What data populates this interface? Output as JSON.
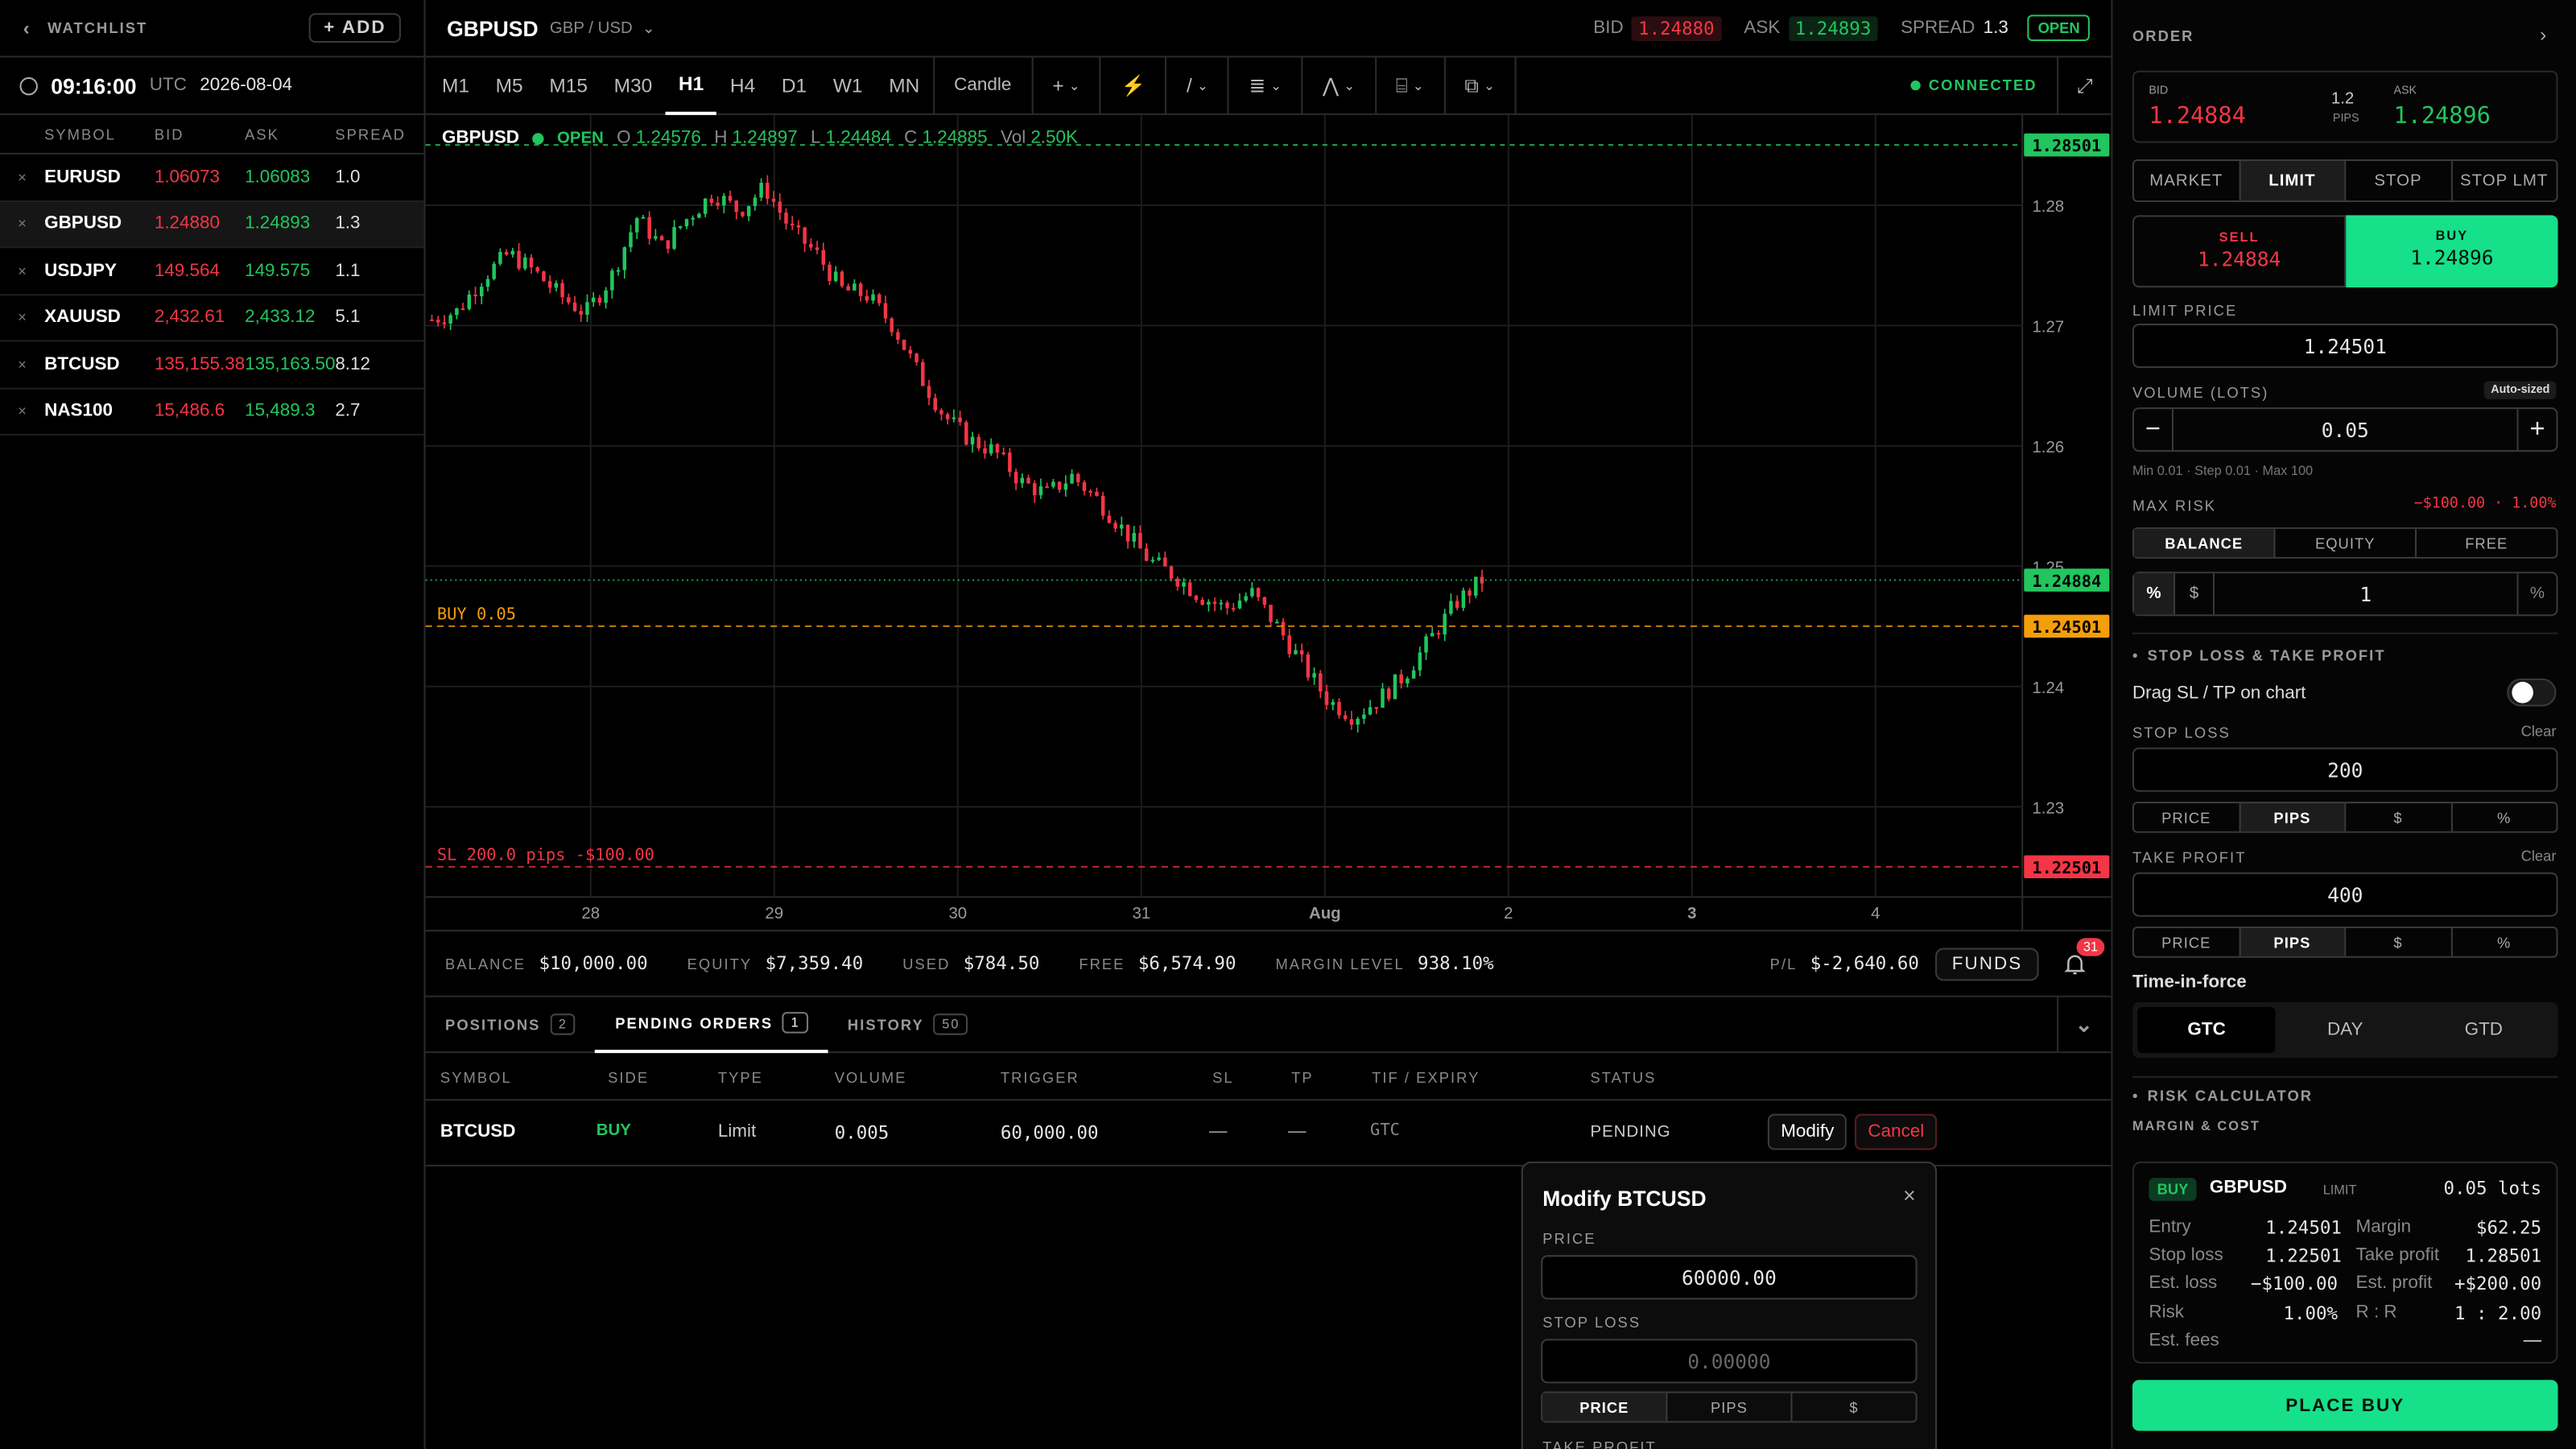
{
  "watchlist": {
    "title": "WATCHLIST",
    "add_label": "+ ADD",
    "clock": {
      "time": "09:16:00",
      "tz": "UTC",
      "date": "2026-08-04"
    },
    "columns": [
      "SYMBOL",
      "BID",
      "ASK",
      "SPREAD"
    ],
    "rows": [
      {
        "remove": "×",
        "symbol": "EURUSD",
        "bid": "1.06073",
        "ask": "1.06083",
        "spread": "1.0"
      },
      {
        "remove": "×",
        "symbol": "GBPUSD",
        "bid": "1.24880",
        "ask": "1.24893",
        "spread": "1.3"
      },
      {
        "remove": "×",
        "symbol": "USDJPY",
        "bid": "149.564",
        "ask": "149.575",
        "spread": "1.1"
      },
      {
        "remove": "×",
        "symbol": "XAUUSD",
        "bid": "2,432.61",
        "ask": "2,433.12",
        "spread": "5.1"
      },
      {
        "remove": "×",
        "symbol": "BTCUSD",
        "bid": "135,155.38",
        "ask": "135,163.50",
        "spread": "8.12"
      },
      {
        "remove": "×",
        "symbol": "NAS100",
        "bid": "15,486.6",
        "ask": "15,489.3",
        "spread": "2.7"
      }
    ]
  },
  "header": {
    "symbol": "GBPUSD",
    "pair": "GBP / USD",
    "bid_label": "BID",
    "bid": "1.24880",
    "ask_label": "ASK",
    "ask": "1.24893",
    "spread_label": "SPREAD",
    "spread": "1.3",
    "status": "OPEN"
  },
  "toolbar": {
    "timeframes": [
      "M1",
      "M5",
      "M15",
      "M30",
      "H1",
      "H4",
      "D1",
      "W1",
      "MN"
    ],
    "active_timeframe": "H1",
    "chart_type": "Candle",
    "connection": "CONNECTED"
  },
  "chart": {
    "legend_symbol": "GBPUSD",
    "legend_status": "OPEN",
    "ohlc": {
      "o_label": "O",
      "o": "1.24576",
      "h_label": "H",
      "h": "1.24897",
      "l_label": "L",
      "l": "1.24484",
      "c_label": "C",
      "c": "1.24885",
      "vol_label": "Vol",
      "vol": "2.50K"
    },
    "price_ticks": [
      "1.28",
      "1.27",
      "1.26",
      "1.25",
      "1.24",
      "1.23"
    ],
    "date_ticks": [
      "28",
      "29",
      "30",
      "31",
      "Aug",
      "2",
      "3",
      "4"
    ],
    "tp_price": "1.28501",
    "bid_price": "1.24884",
    "entry_price": "1.24501",
    "sl_price": "1.22501",
    "entry_label": "BUY 0.05",
    "sl_label": "SL 200.0 pips -$100.00",
    "colors": {
      "up": "#22c55e",
      "down": "#f23645",
      "entry": "#f59e0b"
    }
  },
  "chart_data": {
    "type": "candlestick",
    "symbol": "GBPUSD",
    "timeframe": "H1",
    "ylim": [
      1.2225,
      1.2875
    ],
    "x_ticks": [
      "28",
      "29",
      "30",
      "31",
      "Aug",
      "2",
      "3",
      "4"
    ],
    "levels": {
      "take_profit": 1.28501,
      "bid": 1.24884,
      "entry": 1.24501,
      "stop_loss": 1.22501
    },
    "close_path": [
      1.2705,
      1.2712,
      1.274,
      1.276,
      1.2745,
      1.2725,
      1.271,
      1.274,
      1.279,
      1.2765,
      1.279,
      1.281,
      1.2795,
      1.2815,
      1.278,
      1.276,
      1.273,
      1.2725,
      1.27,
      1.266,
      1.2625,
      1.2605,
      1.2595,
      1.257,
      1.256,
      1.2575,
      1.2555,
      1.253,
      1.2505,
      1.2492,
      1.2475,
      1.2465,
      1.2478,
      1.245,
      1.2418,
      1.2388,
      1.2375,
      1.239,
      1.241,
      1.244,
      1.247,
      1.24885
    ]
  },
  "account": {
    "balance_label": "BALANCE",
    "balance": "$10,000.00",
    "equity_label": "EQUITY",
    "equity": "$7,359.40",
    "used_label": "USED",
    "used": "$784.50",
    "free_label": "FREE",
    "free": "$6,574.90",
    "margin_label": "MARGIN LEVEL",
    "margin": "938.10%",
    "pl_label": "P/L",
    "pl": "$-2,640.60",
    "funds_label": "FUNDS",
    "notifications": "31"
  },
  "tabs": [
    {
      "label": "POSITIONS",
      "count": "2"
    },
    {
      "label": "PENDING ORDERS",
      "count": "1"
    },
    {
      "label": "HISTORY",
      "count": "50"
    }
  ],
  "orders_table": {
    "columns": [
      "SYMBOL",
      "SIDE",
      "TYPE",
      "VOLUME",
      "TRIGGER",
      "SL",
      "TP",
      "TIF / EXPIRY",
      "STATUS"
    ],
    "row": {
      "symbol": "BTCUSD",
      "side": "BUY",
      "type": "Limit",
      "volume": "0.005",
      "trigger": "60,000.00",
      "sl": "—",
      "tp": "—",
      "tif": "GTC",
      "status": "PENDING",
      "modify": "Modify",
      "cancel": "Cancel"
    }
  },
  "modify_modal": {
    "title": "Modify BTCUSD",
    "close": "×",
    "price_label": "PRICE",
    "price": "60000.00",
    "sl_label": "STOP LOSS",
    "sl_placeholder": "0.00000",
    "modes": [
      "PRICE",
      "PIPS",
      "$"
    ],
    "tp_label": "TAKE PROFIT"
  },
  "order": {
    "title": "ORDER",
    "bid_label": "BID",
    "bid": "1.24884",
    "spread": "1.2",
    "spread_unit": "PIPS",
    "ask_label": "ASK",
    "ask": "1.24896",
    "types": [
      "MARKET",
      "LIMIT",
      "STOP",
      "STOP LMT"
    ],
    "active_type": "LIMIT",
    "sell_label": "SELL",
    "sell_price": "1.24884",
    "buy_label": "BUY",
    "buy_price": "1.24896",
    "limit_price_label": "LIMIT PRICE",
    "limit_price": "1.24501",
    "volume_label": "VOLUME (LOTS)",
    "auto_sized": "Auto-sized",
    "volume": "0.05",
    "minus": "−",
    "plus": "+",
    "volume_hint": "Min 0.01 · Step 0.01 · Max 100",
    "max_risk_label": "MAX RISK",
    "max_risk_value": "−$100.00 · 1.00%",
    "risk_bases": [
      "BALANCE",
      "EQUITY",
      "FREE"
    ],
    "risk_pct_sym": "%",
    "risk_usd_sym": "$",
    "risk_value": "1",
    "risk_unit": "%",
    "sltp_section": "STOP LOSS & TAKE PROFIT",
    "drag_label": "Drag SL / TP on chart",
    "sl_label": "STOP LOSS",
    "clear": "Clear",
    "sl_value": "200",
    "tp_label": "TAKE PROFIT",
    "tp_value": "400",
    "modes": [
      "PRICE",
      "PIPS",
      "$",
      "%"
    ],
    "tif_label": "Time-in-force",
    "tif_options": [
      "GTC",
      "DAY",
      "GTD"
    ],
    "risk_calc": "RISK CALCULATOR",
    "margin_cost": "MARGIN & COST",
    "summary": {
      "side": "BUY",
      "symbol": "GBPUSD",
      "type": "LIMIT",
      "lots": "0.05 lots",
      "entry_label": "Entry",
      "entry": "1.24501",
      "margin_label": "Margin",
      "margin": "$62.25",
      "sl_label": "Stop loss",
      "sl": "1.22501",
      "tp_label": "Take profit",
      "tp": "1.28501",
      "est_loss_label": "Est. loss",
      "est_loss": "−$100.00",
      "est_profit_label": "Est. profit",
      "est_profit": "+$200.00",
      "risk_label": "Risk",
      "risk": "1.00%",
      "rr_label": "R : R",
      "rr": "1 : 2.00",
      "fees_label": "Est. fees",
      "fees": "—"
    },
    "place_label": "PLACE BUY"
  }
}
